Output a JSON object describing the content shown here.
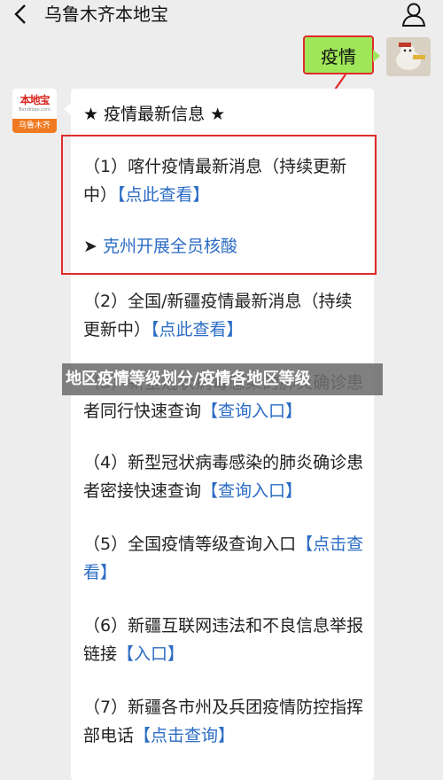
{
  "header": {
    "back_icon": "chevron-left-icon",
    "title": "乌鲁木齐本地宝",
    "profile_icon": "person-icon"
  },
  "outgoing": {
    "text": "疫情"
  },
  "incoming": {
    "logo_text": "本地宝",
    "logo_subtext": "Bendibao.com",
    "logo_band": "乌鲁木齐",
    "title": "★ 疫情最新信息 ★",
    "items": [
      {
        "text": "（1）喀什疫情最新消息（持续更新中）",
        "link": "【点此查看】"
      },
      {
        "text": "➤ ",
        "link": "克州开展全员核酸"
      },
      {
        "text": "（2）全国/新疆疫情最新消息（持续更新中）",
        "link": "【点此查看】"
      },
      {
        "text": "（3）新型冠状病毒感染的肺炎确诊患者同行快速查询",
        "link": "【查询入口】"
      },
      {
        "text": "（4）新型冠状病毒感染的肺炎确诊患者密接快速查询",
        "link": "【查询入口】"
      },
      {
        "text": "（5）全国疫情等级查询入口",
        "link": "【点击查看】"
      },
      {
        "text": "（6）新疆互联网违法和不良信息举报链接",
        "link": "【入口】"
      },
      {
        "text": "（7）新疆各市州及兵团疫情防控指挥部电话",
        "link": "【点击查询】"
      }
    ]
  },
  "overlay": {
    "text": "地区疫情等级划分/疫情各地区等级"
  },
  "colors": {
    "bubble_green": "#9fe658",
    "link_blue": "#2b6cc4",
    "annotation_red": "#e02a2a",
    "logo_orange": "#ef7a21"
  }
}
